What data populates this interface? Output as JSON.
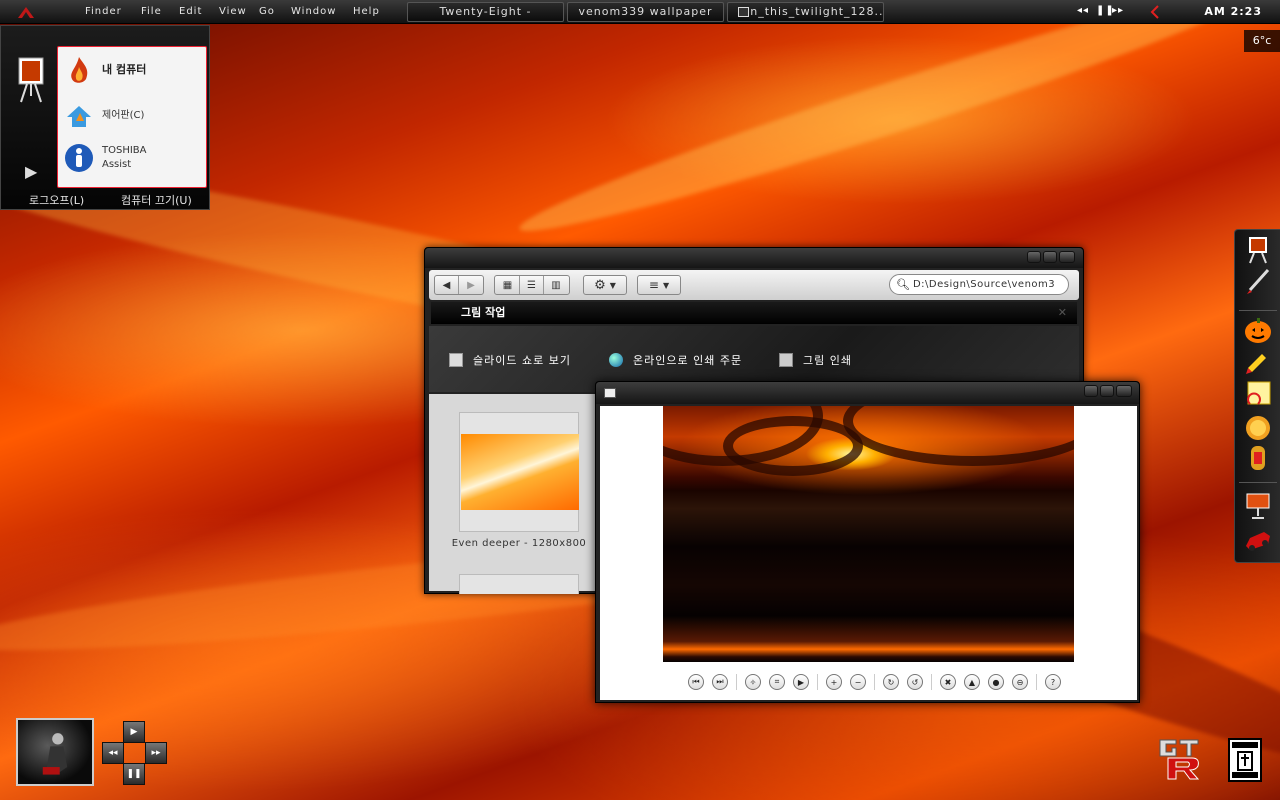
{
  "topbar": {
    "menu": [
      "Finder",
      "File",
      "Edit",
      "View",
      "Go",
      "Window",
      "Help"
    ],
    "tasks": [
      "Twenty-Eight -",
      "venom339 wallpaper",
      "In_this_twilight_128..."
    ],
    "media": {
      "prev": "◂◂",
      "pause": "❚❚",
      "next": "▸▸"
    },
    "clock": "AM 2:23"
  },
  "weather": {
    "temp": "6°c"
  },
  "start_menu": {
    "items": [
      {
        "label": "내 컴퓨터"
      },
      {
        "label": "제어판(C)"
      },
      {
        "label_line1": "TOSHIBA",
        "label_line2": "Assist"
      }
    ],
    "logoff": "로그오프(L)",
    "shutdown": "컴퓨터 끄기(U)"
  },
  "explorer": {
    "search_value": "D:\\Design\\Source\\venom3",
    "tasks_header": "그림 작업",
    "tasks": [
      "슬라이드 쇼로 보기",
      "온라인으로 인쇄 주문",
      "그림 인쇄"
    ],
    "thumbnail_caption": "Even deeper - 1280x800"
  },
  "colors": {
    "accent": "#e02020",
    "wallpaper": "#ff5a00",
    "chrome": "#1a1a1a"
  }
}
